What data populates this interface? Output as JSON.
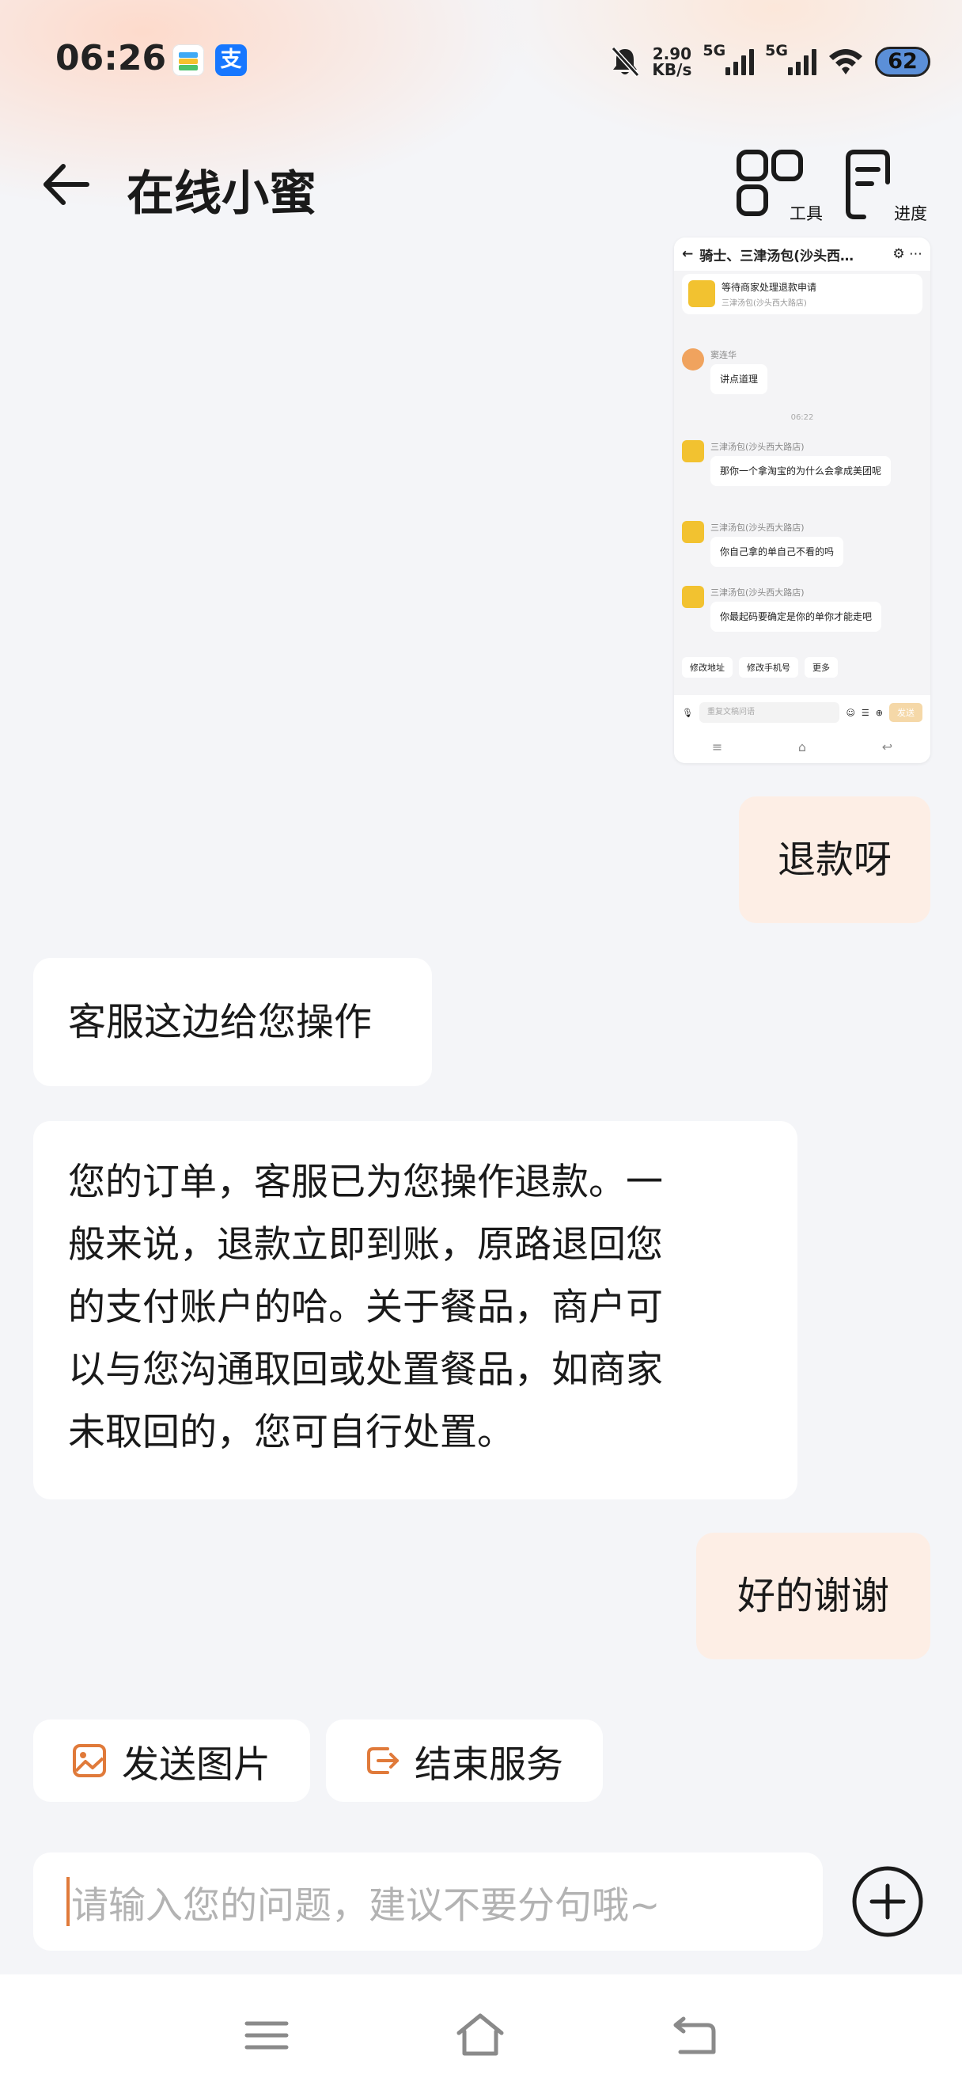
{
  "status_bar": {
    "time": "06:26",
    "net_speed_value": "2.90",
    "net_speed_unit": "KB/s",
    "sim1": "5G",
    "sim2": "5G",
    "battery": "62",
    "icons": [
      "wallet-app-icon",
      "alipay-app-icon",
      "mute-bell-icon",
      "signal-icon",
      "signal-icon",
      "wifi-icon",
      "battery-icon"
    ],
    "alipay_glyph": "支"
  },
  "header": {
    "title": "在线小蜜",
    "tools_label": "工具",
    "progress_label": "进度"
  },
  "screenshot_thumb": {
    "top_title": "骑士、三津汤包(沙头西…",
    "order_status": "等待商家处理退款申请",
    "order_shop": "三津汤包(沙头西大路店)",
    "user_name": "窦连华",
    "user_msg": "讲点道理",
    "time": "06:22",
    "shop_name": "三津汤包(沙头西大路店)",
    "shop_msg1": "那你一个拿淘宝的为什么会拿成美团呢",
    "shop_msg2": "你自己拿的单自己不看的吗",
    "shop_msg3": "你最起码要确定是你的单你才能走吧",
    "chips": [
      "修改地址",
      "修改手机号",
      "更多"
    ],
    "input_placeholder": "重复文稿问语",
    "send": "发送"
  },
  "messages": [
    {
      "from": "me",
      "text": "退款呀"
    },
    {
      "from": "cs",
      "text": "客服这边给您操作"
    },
    {
      "from": "cs",
      "lines": [
        "您的订单，客服已为您操作退款。一",
        "般来说，退款立即到账，原路退回您",
        "的支付账户的哈。关于餐品，商户可",
        "以与您沟通取回或处置餐品，如商家",
        "未取回的，您可自行处置。"
      ]
    },
    {
      "from": "me",
      "text": "好的谢谢"
    }
  ],
  "quick_actions": {
    "send_image": "发送图片",
    "end_service": "结束服务"
  },
  "composer": {
    "placeholder": "请输入您的问题，建议不要分句哦~"
  },
  "colors": {
    "accent": "#e07a3a",
    "my_bubble": "#fdeee5",
    "page_bg": "#f4f5f8"
  }
}
